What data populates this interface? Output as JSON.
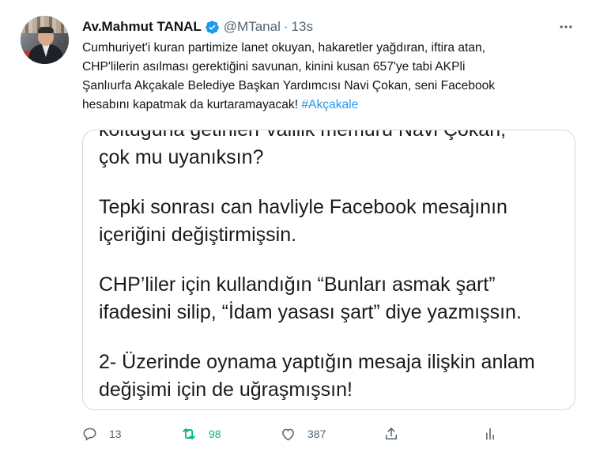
{
  "tweet": {
    "author_name": "Av.Mahmut TANAL",
    "handle": "@MTanal",
    "separator": "·",
    "time": "13s",
    "text_lines": [
      "Cumhuriyet'i kuran partimize lanet okuyan, hakaretler yağdıran, iftira atan,",
      "CHP'lilerin asılması gerektiğini savunan, kinini kusan 657'ye tabi AKPli",
      "Şanlıurfa Akçakale Belediye Başkan Yardımcısı Navi Çokan, seni Facebook",
      "hesabını kapatmak da kurtaramayacak! "
    ],
    "hashtag": "#Akçakale"
  },
  "media": {
    "lines": [
      "koltuğuna getirilen Valilik memuru Navi Çokan,",
      "çok mu uyanıksın?",
      "",
      "Tepki sonrası can havliyle Facebook mesajının",
      "içeriğini değiştirmişsin.",
      "",
      "CHP’liler için kullandığın “Bunları asmak şart”",
      "ifadesini silip, “İdam yasası şart” diye yazmışsın.",
      "",
      "2- Üzerinde oynama yaptığın mesaja ilişkin anlam",
      "değişimi için de uğraşmışsın!"
    ]
  },
  "actions": {
    "reply_count": "13",
    "retweet_count": "98",
    "like_count": "387"
  },
  "icons": {
    "verified": "verified-badge-icon",
    "more": "more-icon",
    "reply": "reply-icon",
    "retweet": "retweet-icon",
    "like": "like-icon",
    "share": "share-icon",
    "analytics": "analytics-icon"
  },
  "colors": {
    "text": "#0f1419",
    "secondary": "#536471",
    "link": "#1d9bf0",
    "retweet_active": "#00ba7c",
    "border": "#cfd9de"
  }
}
